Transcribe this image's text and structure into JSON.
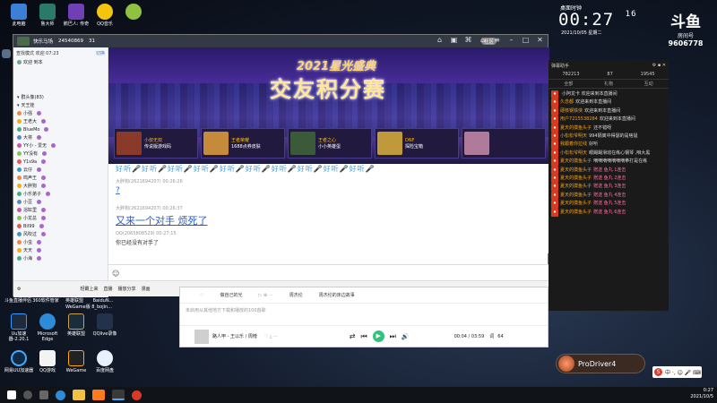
{
  "desktop": {
    "icons_top": [
      "此电脑",
      "鲁大师",
      "鹅巴人: 传奇",
      "QQ音乐"
    ],
    "icons_left": [
      "DeskTop",
      "回收站",
      "火绒",
      "软件安装",
      "网络",
      "QQ游戏",
      "火绒安全",
      "Bing",
      "浏览器",
      "照片",
      "设置",
      "视频",
      "小爱",
      "腾讯"
    ],
    "icons_bottom_row1": [
      "Uu加速器-2.20.1",
      "Microsoft Edge",
      "英雄联盟",
      "QQlive录像"
    ],
    "icons_bottom_row2": [
      "网易UU加速器",
      "QQ游戏",
      "WeGame",
      "百度网盘"
    ],
    "icons_mid": [
      "斗鱼直播伴侣",
      "360软件管家",
      "英雄联盟",
      "BaiduN..."
    ],
    "mid_sub": "WeGame版   8_bojin..."
  },
  "clock": {
    "title": "桌面时钟",
    "time": "00:27",
    "seconds": "16",
    "date": "2021/10/05  星期二"
  },
  "brand": {
    "logo": "斗鱼",
    "sub": "房间号",
    "room": "9606778"
  },
  "qq_window": {
    "group_name": "快乐马场",
    "group_id": "24540869",
    "member_count": "31",
    "badge": "社区",
    "left_header": "查找模式 欢迎 07:23",
    "left_header_right": "切换",
    "left_list_title": "欢迎 到本",
    "group_section": "群头像(83)",
    "sub_section": "天王娃",
    "members": [
      "小强",
      "王老大",
      "BlueMo",
      "大将",
      "YY小 - 爱无",
      "YY没有",
      "Y1s9a",
      "云仔",
      "鸣声王",
      "大胖狗",
      "小乐弟子",
      "小豆",
      "浴缸里",
      "小龙总",
      "Bil99",
      "风吹过",
      "小虫",
      "天天",
      "小海"
    ],
    "banner_title_small": "2021星光盛典",
    "banner_title_big": "交友积分赛",
    "banner_cards": [
      {
        "tag": "小叔无双",
        "label": "传说版游戏码"
      },
      {
        "tag": "王者荣耀",
        "label": "1688点券皮肤"
      },
      {
        "tag": "王者之心",
        "label": "小小英雄蛋"
      },
      {
        "tag": "DNF",
        "label": "探险宝箱"
      },
      {
        "tag": "",
        "label": ""
      }
    ],
    "emoji_strip": "好听🎤好听🎤好听🎤好听🎤好听🎤好听🎤好听🎤好听🎤好听🎤好听🎤",
    "messages": [
      {
        "user": "大胖狗(2621694207)",
        "time": "00:26:26",
        "text": "?",
        "style": "link"
      },
      {
        "user": "大胖狗(2621694207)",
        "time": "00:26:37",
        "text": "又来一个对手 烦死了",
        "style": "big"
      },
      {
        "user": "QQ(2065808529)",
        "time": "00:27:15",
        "text": "你已经没有对手了",
        "style": "plain"
      }
    ],
    "bottom_bar": [
      "轻霸上来",
      "直播",
      "播放分享",
      "漫画"
    ],
    "top_tools": [
      "⌂",
      "▣",
      "⌘",
      "⌂",
      "≡",
      "–",
      "□",
      "✕"
    ]
  },
  "music": {
    "row_song": "做自己的光",
    "row_artist": "周杰伦",
    "row_album": "周杰伦的床边故事",
    "notice": "未启用从其他地方下载和播放的100首歌",
    "player_song": "路人甲 - 王以乐 / 周榜",
    "time": "00:04 / 03:59",
    "quality": "词",
    "count": "64"
  },
  "right_panel": {
    "title": "弹幕助手",
    "stats": [
      "782213",
      "87",
      "19545"
    ],
    "tabs": [
      "全部",
      "礼物",
      "互动"
    ],
    "lines": [
      {
        "tag": "",
        "name": "",
        "text": "小阿龙卡 欢迎来到本直播间",
        "kind": "sys"
      },
      {
        "tag": "",
        "name": "久念都",
        "text": "欢迎来到本直播间",
        "kind": "sys"
      },
      {
        "tag": "",
        "name": "硬核钢铁侠",
        "text": "欢迎来到本直播间",
        "kind": "sys"
      },
      {
        "tag": "",
        "name": "用户7215538284",
        "text": "欢迎来到本直播间",
        "kind": "sys"
      },
      {
        "tag": "",
        "name": "",
        "text": "",
        "kind": "blank"
      },
      {
        "tag": "",
        "name": "夏天的摸鱼头子",
        "text": "还不错呀",
        "kind": "msg"
      },
      {
        "tag": "",
        "name": "小松松爷明天",
        "text": "994隔离中得瑟的是啥鼠",
        "kind": "msg"
      },
      {
        "tag": "",
        "name": "",
        "text": "",
        "kind": "blank"
      },
      {
        "tag": "",
        "name": "我跟着你拉线",
        "text": "好听",
        "kind": "msg"
      },
      {
        "tag": "",
        "name": "",
        "text": "",
        "kind": "blank"
      },
      {
        "tag": "",
        "name": "小松松爷明天",
        "text": "眼踢踢滑动在练心钢琴 ,咱大黑",
        "kind": "msg"
      },
      {
        "tag": "",
        "name": "",
        "text": "",
        "kind": "blank"
      },
      {
        "tag": "",
        "name": "夏天的摸鱼头子",
        "text": "嘀嘀嘀嘀嘀嘀嘀拳打是在练",
        "kind": "msg"
      },
      {
        "tag": "",
        "name": "",
        "text": "",
        "kind": "blank"
      },
      {
        "tag": "",
        "name": "夏天的摸鱼头子",
        "text": "赠送 鱼丸 1连击",
        "kind": "gift"
      },
      {
        "tag": "",
        "name": "夏天的摸鱼头子",
        "text": "赠送 鱼丸 2连击",
        "kind": "gift"
      },
      {
        "tag": "",
        "name": "夏天的摸鱼头子",
        "text": "赠送 鱼丸 3连击",
        "kind": "gift"
      },
      {
        "tag": "",
        "name": "夏天的摸鱼头子",
        "text": "赠送 鱼丸 4连击",
        "kind": "gift"
      },
      {
        "tag": "",
        "name": "夏天的摸鱼头子",
        "text": "赠送 鱼丸 5连击",
        "kind": "gift"
      },
      {
        "tag": "",
        "name": "夏天的摸鱼头子",
        "text": "赠送 鱼丸 6连击",
        "kind": "gift"
      }
    ]
  },
  "probar": {
    "text": "ProDriver4"
  },
  "ime": {
    "label": "中 ·, ☺ 🎤 ⌨"
  },
  "taskbar": {
    "time": "0:27",
    "date": "2021/10/5"
  }
}
